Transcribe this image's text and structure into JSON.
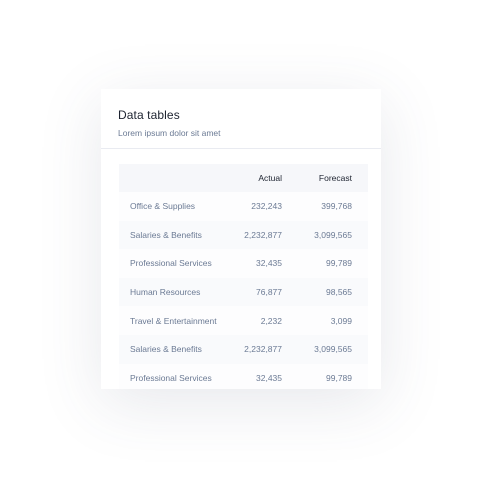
{
  "card": {
    "title": "Data tables",
    "subtitle": "Lorem ipsum dolor sit amet"
  },
  "table": {
    "columns": [
      "",
      "Actual",
      "Forecast"
    ],
    "rows": [
      {
        "label": "Office & Supplies",
        "actual": "232,243",
        "forecast": "399,768"
      },
      {
        "label": "Salaries & Benefits",
        "actual": "2,232,877",
        "forecast": "3,099,565"
      },
      {
        "label": "Professional Services",
        "actual": "32,435",
        "forecast": "99,789"
      },
      {
        "label": "Human Resources",
        "actual": "76,877",
        "forecast": "98,565"
      },
      {
        "label": "Travel & Entertainment",
        "actual": "2,232",
        "forecast": "3,099"
      },
      {
        "label": "Salaries & Benefits",
        "actual": "2,232,877",
        "forecast": "3,099,565"
      },
      {
        "label": "Professional Services",
        "actual": "32,435",
        "forecast": "99,789"
      }
    ]
  }
}
